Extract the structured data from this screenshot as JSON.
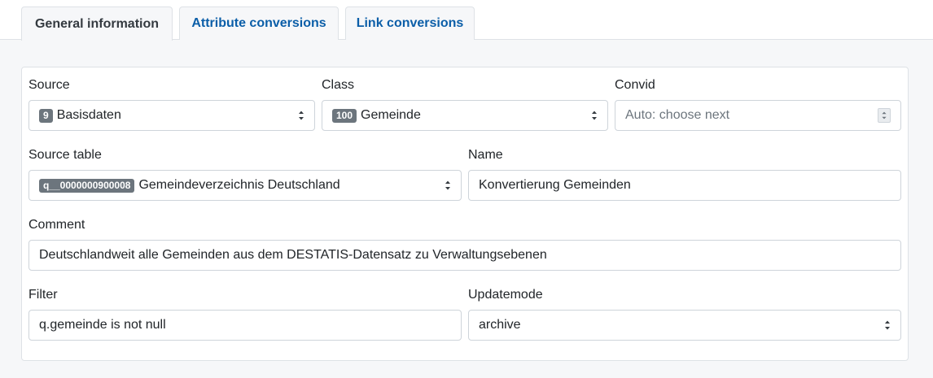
{
  "tabs": [
    {
      "label": "General information",
      "active": true
    },
    {
      "label": "Attribute conversions",
      "active": false
    },
    {
      "label": "Link conversions",
      "active": false
    }
  ],
  "form": {
    "source": {
      "label": "Source",
      "badge": "9",
      "value": "Basisdaten"
    },
    "class": {
      "label": "Class",
      "badge": "100",
      "value": "Gemeinde"
    },
    "convid": {
      "label": "Convid",
      "placeholder": "Auto: choose next"
    },
    "source_table": {
      "label": "Source table",
      "badge": "q__0000000900008",
      "value": "Gemeindeverzeichnis Deutschland"
    },
    "name": {
      "label": "Name",
      "value": "Konvertierung Gemeinden"
    },
    "comment": {
      "label": "Comment",
      "value": "Deutschlandweit alle Gemeinden aus dem DESTATIS-Datensatz zu Verwaltungsebenen"
    },
    "filter": {
      "label": "Filter",
      "value": "q.gemeinde is not null"
    },
    "updatemode": {
      "label": "Updatemode",
      "value": "archive"
    }
  },
  "colors": {
    "tab_link": "#0b5ea8",
    "tab_active": "#343a40",
    "badge_bg": "#6c757d",
    "page_bg": "#f6f7f9"
  }
}
